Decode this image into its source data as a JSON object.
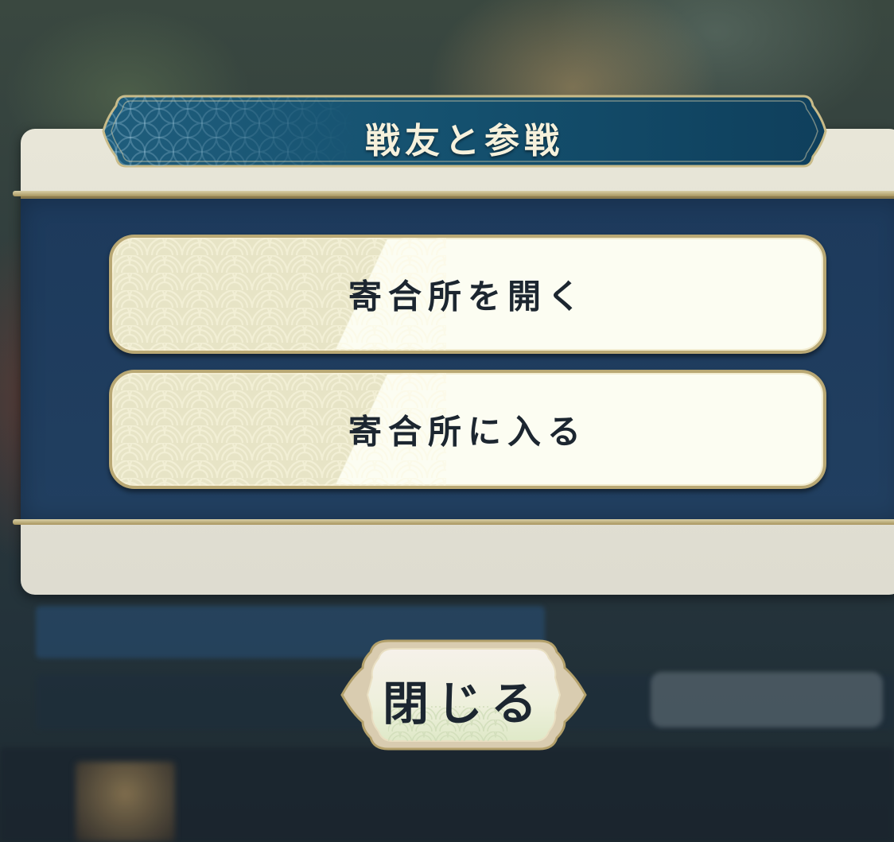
{
  "dialog": {
    "title": "戦友と参戦",
    "options": [
      {
        "label": "寄合所を開く"
      },
      {
        "label": "寄合所に入る"
      }
    ]
  },
  "close_button": {
    "label": "閉じる"
  },
  "colors": {
    "panel_navy": "#1d3a5c",
    "panel_cream": "#e8e6d8",
    "button_cream": "#fcfdf2",
    "gold_trim": "#b9a874",
    "banner_teal": "#14506e"
  }
}
